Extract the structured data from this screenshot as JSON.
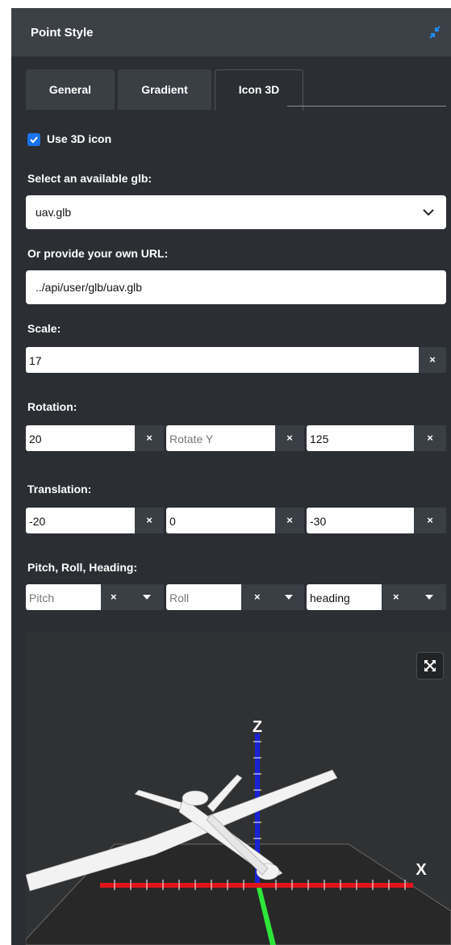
{
  "panel": {
    "title": "Point Style",
    "tabs": [
      {
        "label": "General"
      },
      {
        "label": "Gradient"
      },
      {
        "label": "Icon 3D",
        "active": true
      }
    ]
  },
  "icon3d": {
    "use_3d_icon": {
      "label": "Use 3D icon",
      "checked": true
    },
    "glb_select": {
      "label": "Select an available glb:",
      "value": "uav.glb"
    },
    "custom_url": {
      "label": "Or provide your own URL:",
      "value": "../api/user/glb/uav.glb"
    },
    "scale": {
      "label": "Scale:",
      "value": "17",
      "clear": "×"
    },
    "rotation": {
      "label": "Rotation:",
      "x": {
        "value": "20",
        "clear": "×"
      },
      "y": {
        "placeholder": "Rotate Y",
        "clear": "×"
      },
      "z": {
        "value": "125",
        "clear": "×"
      }
    },
    "translation": {
      "label": "Translation:",
      "x": {
        "value": "-20",
        "clear": "×"
      },
      "y": {
        "value": "0",
        "clear": "×"
      },
      "z": {
        "value": "-30",
        "clear": "×"
      }
    },
    "orientation": {
      "label": "Pitch, Roll, Heading:",
      "pitch": {
        "placeholder": "Pitch",
        "clear": "×"
      },
      "roll": {
        "placeholder": "Roll",
        "clear": "×"
      },
      "heading": {
        "value": "heading",
        "clear": "×"
      }
    }
  },
  "viewer": {
    "axis_labels": {
      "z": "Z",
      "x": "X"
    },
    "colors": {
      "x_axis": "#e0141b",
      "z_axis": "#1a22d6",
      "y_axis": "#2ee63a",
      "accent": "#1a73e8"
    }
  }
}
